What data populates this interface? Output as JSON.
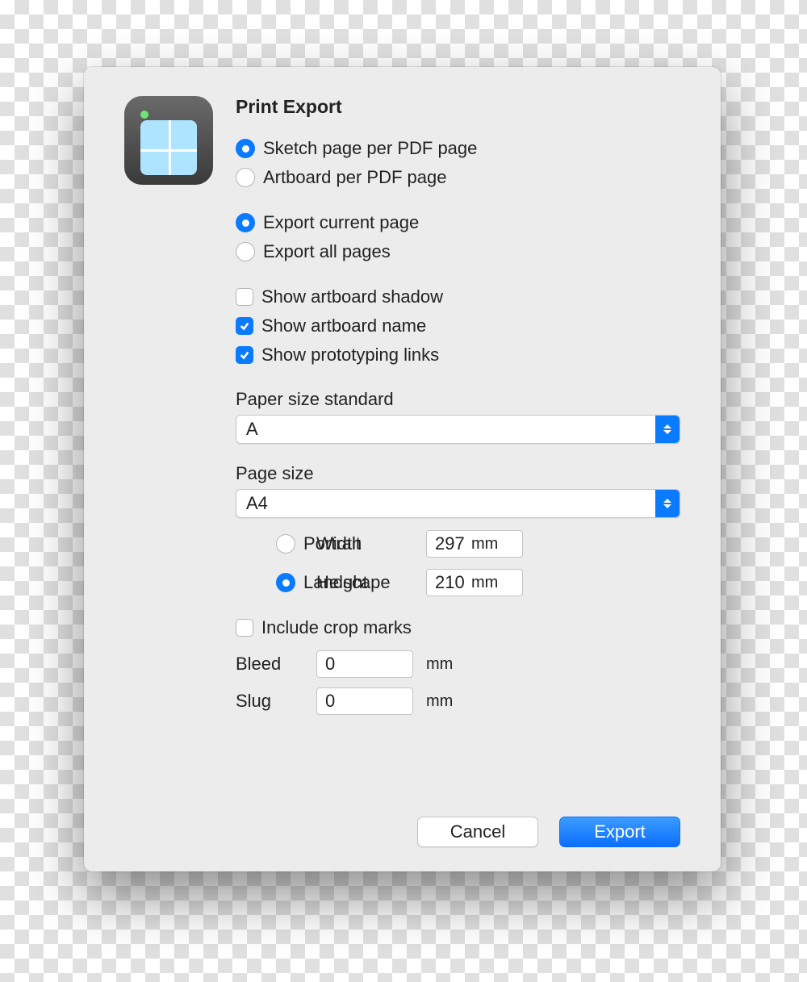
{
  "dialog": {
    "title": "Print Export",
    "radios": {
      "pageMode": {
        "sketchPerPdf": "Sketch page per PDF page",
        "artboardPerPdf": "Artboard per PDF page"
      },
      "exportScope": {
        "current": "Export current page",
        "all": "Export all pages"
      },
      "orientation": {
        "portrait": "Portrait",
        "landscape": "Landscape"
      }
    },
    "checkboxes": {
      "showShadow": "Show artboard shadow",
      "showName": "Show artboard name",
      "showProto": "Show prototyping links",
      "cropMarks": "Include crop marks"
    },
    "labels": {
      "paperStandard": "Paper size standard",
      "pageSize": "Page size",
      "width": "Width",
      "height": "Height",
      "bleed": "Bleed",
      "slug": "Slug",
      "unit": "mm"
    },
    "values": {
      "paperStandard": "A",
      "pageSize": "A4",
      "width": "297",
      "height": "210",
      "bleed": "0",
      "slug": "0"
    },
    "buttons": {
      "cancel": "Cancel",
      "export": "Export"
    }
  }
}
